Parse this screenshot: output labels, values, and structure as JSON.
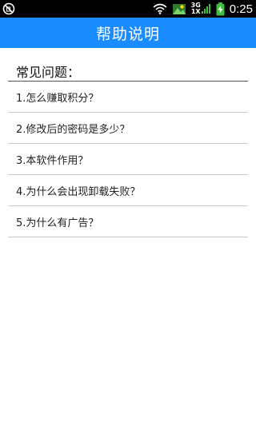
{
  "statusbar": {
    "network_top": "3G",
    "network_bottom": "1X",
    "time": "0:25"
  },
  "header": {
    "title": "帮助说明"
  },
  "faq": {
    "heading": "常见问题：",
    "items": [
      {
        "label": "1.怎么赚取积分？"
      },
      {
        "label": "2.修改后的密码是多少？"
      },
      {
        "label": "3.本软件作用？"
      },
      {
        "label": "4.为什么会出现卸载失败？"
      },
      {
        "label": "5.为什么有广告？"
      }
    ]
  },
  "colors": {
    "accent": "#1a8cff",
    "statusbar": "#000000"
  }
}
